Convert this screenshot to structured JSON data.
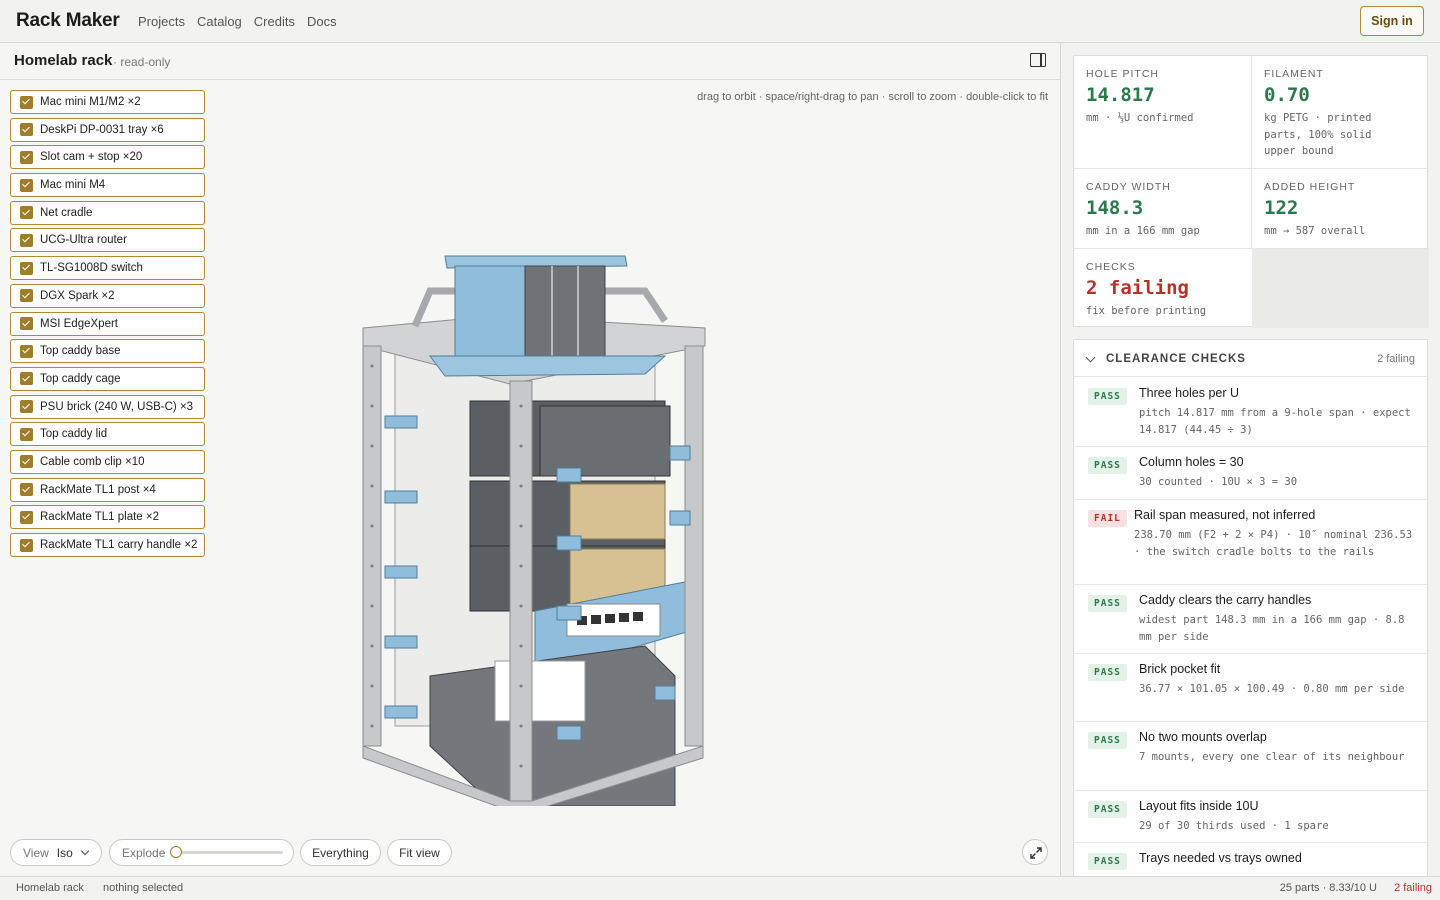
{
  "app": {
    "brand": "Rack Maker",
    "nav": [
      "Projects",
      "Catalog",
      "Credits",
      "Docs"
    ],
    "signin_label": "Sign in"
  },
  "viewer": {
    "project_title": "Homelab rack",
    "project_mode": "· read-only",
    "hint": "drag to orbit · space/right-drag to pan · scroll to zoom · double-click to fit",
    "parts": [
      "Mac mini M1/M2 ×2",
      "DeskPi DP-0031 tray ×6",
      "Slot cam + stop ×20",
      "Mac mini M4",
      "Net cradle",
      "UCG-Ultra router",
      "TL-SG1008D switch",
      "DGX Spark ×2",
      "MSI EdgeXpert",
      "Top caddy base",
      "Top caddy cage",
      "PSU brick (240 W, USB-C) ×3",
      "Top caddy lid",
      "Cable comb clip ×10",
      "RackMate TL1 post ×4",
      "RackMate TL1 plate ×2",
      "RackMate TL1 carry handle ×2"
    ],
    "controls": {
      "view_label": "View",
      "view_value": "Iso",
      "explode_label": "Explode",
      "explode_value": 0,
      "everything_label": "Everything",
      "fit_label": "Fit view"
    }
  },
  "stats": {
    "hole_pitch": {
      "label": "HOLE PITCH",
      "value": "14.817",
      "sub": "mm · ⅓U confirmed"
    },
    "filament": {
      "label": "FILAMENT",
      "value": "0.70",
      "sub": "kg PETG · printed parts, 100% solid upper bound"
    },
    "caddy_width": {
      "label": "CADDY WIDTH",
      "value": "148.3",
      "sub": "mm in a 166 mm gap"
    },
    "added_height": {
      "label": "ADDED HEIGHT",
      "value": "122",
      "sub": "mm → 587 overall"
    },
    "checks": {
      "label": "CHECKS",
      "value": "2 failing",
      "sub": "fix before printing"
    }
  },
  "clearance": {
    "title": "CLEARANCE CHECKS",
    "count": "2 failing",
    "items": [
      {
        "status": "PASS",
        "title": "Three holes per U",
        "detail": "pitch 14.817 mm from a 9-hole span · expect 14.817 (44.45 ÷ 3)"
      },
      {
        "status": "PASS",
        "title": "Column holes = 30",
        "detail": "30 counted · 10U × 3 = 30"
      },
      {
        "status": "FAIL",
        "title": "Rail span measured, not inferred",
        "detail": "238.70 mm (F2 + 2 × P4) · 10″ nominal 236.53 · the switch cradle bolts to the rails"
      },
      {
        "status": "PASS",
        "title": "Caddy clears the carry handles",
        "detail": "widest part 148.3 mm in a 166 mm gap · 8.8 mm per side"
      },
      {
        "status": "PASS",
        "title": "Brick pocket fit",
        "detail": "36.77 × 101.05 × 100.49 · 0.80 mm per side"
      },
      {
        "status": "PASS",
        "title": "No two mounts overlap",
        "detail": "7 mounts, every one clear of its neighbour"
      },
      {
        "status": "PASS",
        "title": "Layout fits inside 10U",
        "detail": "29 of 30 thirds used · 1 spare"
      },
      {
        "status": "PASS",
        "title": "Trays needed vs trays owned",
        "detail": ""
      }
    ]
  },
  "status_bar": {
    "project": "Homelab rack",
    "selection": "nothing selected",
    "summary": "25 parts · 8.33/10 U",
    "failing": "2 failing"
  },
  "colors": {
    "accent": "#a07c2d",
    "pass": "#2b7a4b",
    "fail": "#b8322c",
    "part_blue": "#8fbddb",
    "device_grey": "#5b5e63",
    "device_tan": "#d7c193"
  }
}
